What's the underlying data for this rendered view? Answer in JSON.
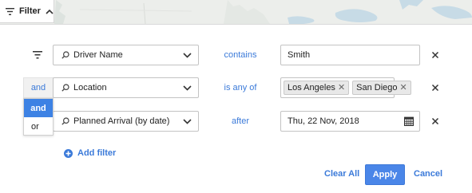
{
  "colors": {
    "accent": "#3b7ad9",
    "apply_button": "#4a86e8",
    "selected_option": "#3d82e4",
    "map_land": "#eceeeb",
    "map_water": "#c7dbe6"
  },
  "toolbar": {
    "filter_label": "Filter",
    "filter_icon": "filter-lines-icon",
    "collapse_icon": "chevron-up-icon"
  },
  "filters": [
    {
      "conjunction": "",
      "field": "Driver Name",
      "operator": "contains",
      "value": "Smith"
    },
    {
      "conjunction": "and",
      "field": "Location",
      "operator": "is any of",
      "chips": [
        "Los Angeles",
        "San Diego"
      ]
    },
    {
      "conjunction": "",
      "field": "Planned Arrival (by date)",
      "operator": "after",
      "value": "Thu, 22 Nov, 2018"
    }
  ],
  "conjunction_menu": {
    "options": [
      "and",
      "or"
    ],
    "selected": "and"
  },
  "actions": {
    "add_filter": "Add filter",
    "clear_all": "Clear All",
    "apply": "Apply",
    "cancel": "Cancel"
  }
}
